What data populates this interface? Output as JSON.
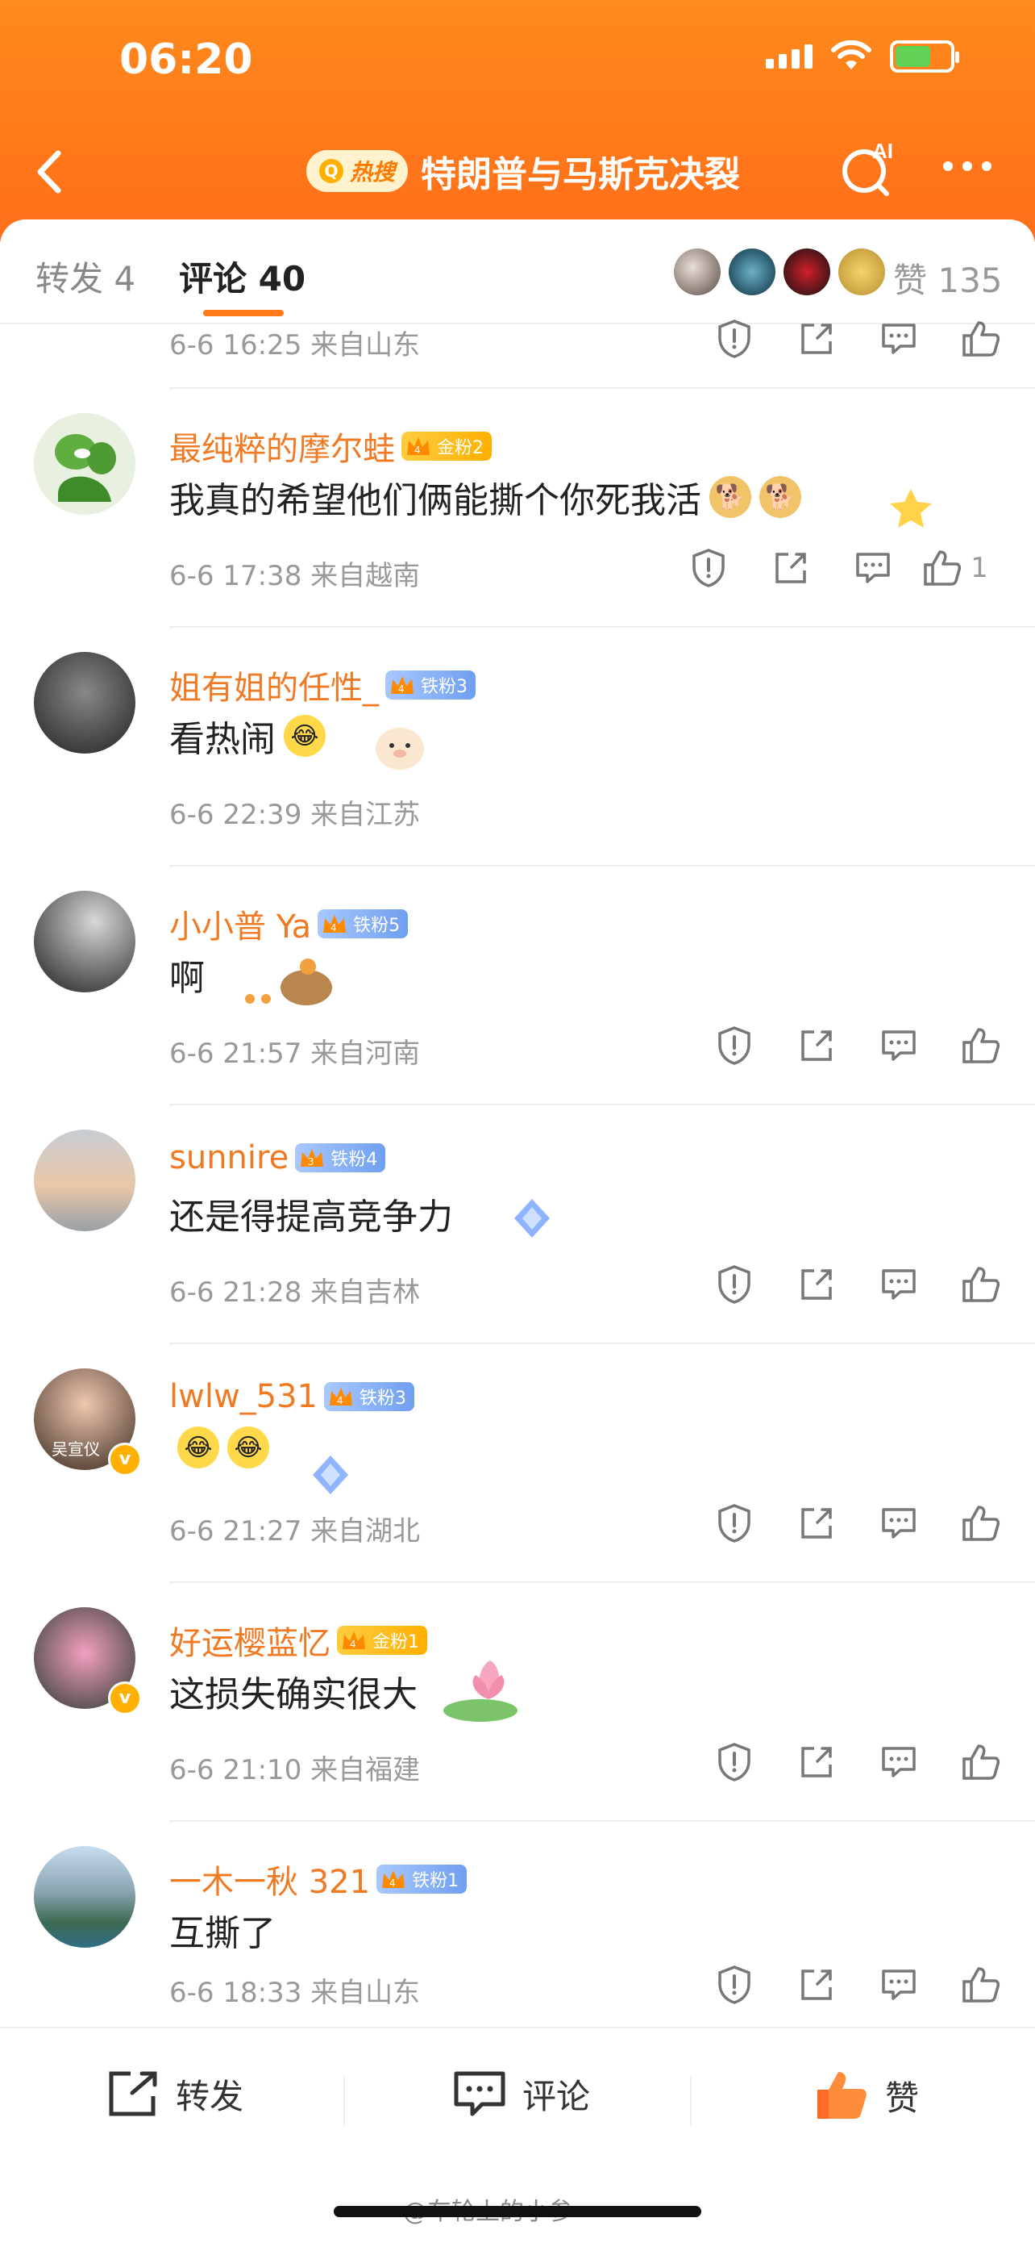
{
  "status_bar": {
    "time": "06:20"
  },
  "nav": {
    "hot_tag": "热搜",
    "title": "特朗普与马斯克决裂",
    "ai_label": "AI"
  },
  "tabs": {
    "forward": "转发 4",
    "comments": "评论 40",
    "likes": "赞 135"
  },
  "partial_comment": {
    "meta": "6-6 16:25 来自山东"
  },
  "comments": [
    {
      "name": "最纯粹的摩尔蛙",
      "badge": "金粉2",
      "badge_level": "4",
      "badge_type": "gold",
      "text": "我真的希望他们俩能撕个你死我活",
      "meta": "6-6 17:38 来自越南",
      "likes": "1"
    },
    {
      "name": "姐有姐的任性_",
      "badge": "铁粉3",
      "badge_level": "4",
      "badge_type": "iron",
      "text": "看热闹",
      "meta": "6-6 22:39 来自江苏",
      "likes": ""
    },
    {
      "name": "小小普 Ya",
      "badge": "铁粉5",
      "badge_level": "4",
      "badge_type": "iron",
      "text": "啊",
      "meta": "6-6 21:57 来自河南",
      "likes": ""
    },
    {
      "name": "sunnire",
      "badge": "铁粉4",
      "badge_level": "3",
      "badge_type": "iron",
      "text": "还是得提高竞争力",
      "meta": "6-6 21:28 来自吉林",
      "likes": ""
    },
    {
      "name": "lwlw_531",
      "badge": "铁粉3",
      "badge_level": "4",
      "badge_type": "iron",
      "text": "",
      "meta": "6-6 21:27 来自湖北",
      "likes": ""
    },
    {
      "name": "好运樱蓝忆",
      "badge": "金粉1",
      "badge_level": "4",
      "badge_type": "gold",
      "text": "这损失确实很大",
      "meta": "6-6 21:10 来自福建",
      "likes": ""
    },
    {
      "name": "一木一秋 321",
      "badge": "铁粉1",
      "badge_level": "4",
      "badge_type": "iron",
      "text": "互撕了",
      "meta": "6-6 18:33 来自山东",
      "likes": ""
    }
  ],
  "avatar_text": {
    "lwlw": "吴宣仪"
  },
  "bottom_bar": {
    "forward": "转发",
    "comment": "评论",
    "like": "赞"
  },
  "watermark": "@车轮上的小参",
  "colors": {
    "brand_orange": "#ff7a1a",
    "username": "#f07a24",
    "meta_gray": "#999999"
  }
}
